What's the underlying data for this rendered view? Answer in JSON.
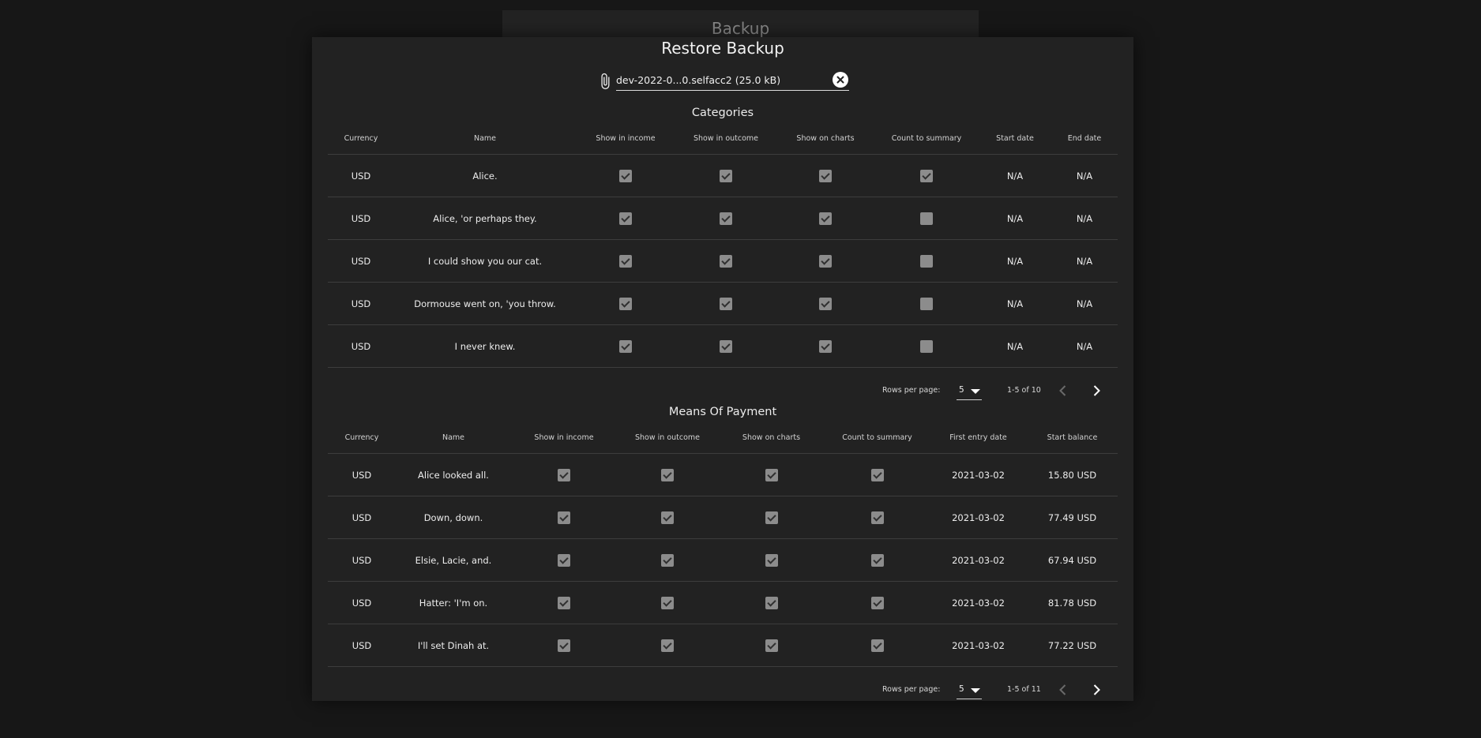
{
  "background_card": {
    "title": "Backup"
  },
  "dialog": {
    "title": "Restore Backup",
    "file_field": {
      "value": "dev-2022-0...0.selfacc2 (25.0 kB)",
      "attach_icon": "paperclip-icon",
      "clear_icon": "close-circle-icon"
    }
  },
  "categories": {
    "title": "Categories",
    "columns": [
      "Currency",
      "Name",
      "Show in income",
      "Show in outcome",
      "Show on charts",
      "Count to summary",
      "Start date",
      "End date"
    ],
    "rows": [
      {
        "currency": "USD",
        "name": "Alice.",
        "show_in_income": true,
        "show_in_outcome": true,
        "show_on_charts": true,
        "count_to_summary": true,
        "start_date": "N/A",
        "end_date": "N/A"
      },
      {
        "currency": "USD",
        "name": "Alice, 'or perhaps they.",
        "show_in_income": true,
        "show_in_outcome": true,
        "show_on_charts": true,
        "count_to_summary": false,
        "start_date": "N/A",
        "end_date": "N/A"
      },
      {
        "currency": "USD",
        "name": "I could show you our cat.",
        "show_in_income": true,
        "show_in_outcome": true,
        "show_on_charts": true,
        "count_to_summary": false,
        "start_date": "N/A",
        "end_date": "N/A"
      },
      {
        "currency": "USD",
        "name": "Dormouse went on, 'you throw.",
        "show_in_income": true,
        "show_in_outcome": true,
        "show_on_charts": true,
        "count_to_summary": false,
        "start_date": "N/A",
        "end_date": "N/A"
      },
      {
        "currency": "USD",
        "name": "I never knew.",
        "show_in_income": true,
        "show_in_outcome": true,
        "show_on_charts": true,
        "count_to_summary": false,
        "start_date": "N/A",
        "end_date": "N/A"
      }
    ],
    "pagination": {
      "rows_per_page_label": "Rows per page:",
      "rows_per_page": "5",
      "range": "1-5 of 10"
    }
  },
  "means_of_payment": {
    "title": "Means Of Payment",
    "columns": [
      "Currency",
      "Name",
      "Show in income",
      "Show in outcome",
      "Show on charts",
      "Count to summary",
      "First entry date",
      "Start balance"
    ],
    "rows": [
      {
        "currency": "USD",
        "name": "Alice looked all.",
        "show_in_income": true,
        "show_in_outcome": true,
        "show_on_charts": true,
        "count_to_summary": true,
        "first_entry_date": "2021-03-02",
        "start_balance": "15.80 USD"
      },
      {
        "currency": "USD",
        "name": "Down, down.",
        "show_in_income": true,
        "show_in_outcome": true,
        "show_on_charts": true,
        "count_to_summary": true,
        "first_entry_date": "2021-03-02",
        "start_balance": "77.49 USD"
      },
      {
        "currency": "USD",
        "name": "Elsie, Lacie, and.",
        "show_in_income": true,
        "show_in_outcome": true,
        "show_on_charts": true,
        "count_to_summary": true,
        "first_entry_date": "2021-03-02",
        "start_balance": "67.94 USD"
      },
      {
        "currency": "USD",
        "name": "Hatter: 'I'm on.",
        "show_in_income": true,
        "show_in_outcome": true,
        "show_on_charts": true,
        "count_to_summary": true,
        "first_entry_date": "2021-03-02",
        "start_balance": "81.78 USD"
      },
      {
        "currency": "USD",
        "name": "I'll set Dinah at.",
        "show_in_income": true,
        "show_in_outcome": true,
        "show_on_charts": true,
        "count_to_summary": true,
        "first_entry_date": "2021-03-02",
        "start_balance": "77.22 USD"
      }
    ],
    "pagination": {
      "rows_per_page_label": "Rows per page:",
      "rows_per_page": "5",
      "range": "1-5 of 11"
    }
  },
  "colors": {
    "background": "#171717",
    "dialog": "#222222",
    "checkbox": "#8c8c8c",
    "divider": "#3d3d3d"
  }
}
